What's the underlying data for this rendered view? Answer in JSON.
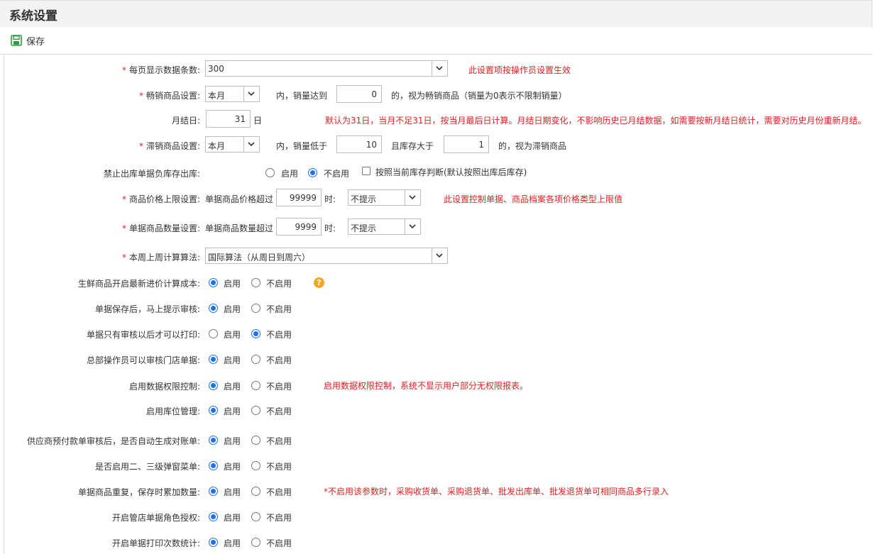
{
  "title": "系统设置",
  "toolbar": {
    "save_label": "保存"
  },
  "colors": {
    "accent": "#1a73e8",
    "note": "#e02020",
    "save_icon": "#2e9b3e",
    "help": "#f5a623"
  },
  "rows": {
    "pagesize": {
      "required": "*",
      "label": "每页显示数据条数:",
      "value": "300",
      "note": "此设置项按操作员设置生效"
    },
    "bestseller": {
      "required": "*",
      "label": "畅销商品设置:",
      "period": "本月",
      "t1": "内，销量达到",
      "qty": "0",
      "t2": "的，视为畅销商品（销量为0表示不限制销量）"
    },
    "monthend": {
      "label": "月结日:",
      "day": "31",
      "unit": "日",
      "note": "默认为31日，当月不足31日，按当月最后日计算。月结日期变化，不影响历史已月结数据，如需要按新月结日统计，需要对历史月份重新月结。"
    },
    "slowseller": {
      "required": "*",
      "label": "滞销商品设置:",
      "period": "本月",
      "t1": "内，销量低于",
      "qty": "10",
      "t2": "且库存大于",
      "stock": "1",
      "t3": "的，视为滞销商品"
    },
    "negstock": {
      "label": "禁止出库单据负库存出库:",
      "enable": "启用",
      "disable": "不启用",
      "check_label": "按照当前库存判断(默认按照出库后库存)"
    },
    "pricelimit": {
      "required": "*",
      "label": "商品价格上限设置:",
      "t1": "单据商品价格超过",
      "value": "99999",
      "t2": "时:",
      "action": "不提示",
      "note": "此设置控制单据、商品档案各项价格类型上限值"
    },
    "qtylimit": {
      "required": "*",
      "label": "单据商品数量设置:",
      "t1": "单据商品数量超过",
      "value": "9999",
      "t2": "时:",
      "action": "不提示"
    },
    "weekcalc": {
      "required": "*",
      "label": "本周上周计算算法:",
      "value": "国际算法（从周日到周六）"
    },
    "fresh": {
      "label": "生鲜商品开启最新进价计算成本:",
      "enable": "启用",
      "disable": "不启用",
      "help": "?"
    },
    "auditprompt": {
      "label": "单据保存后，马上提示审核:",
      "enable": "启用",
      "disable": "不启用"
    },
    "printafter": {
      "label": "单据只有审核以后才可以打印:",
      "enable": "启用",
      "disable": "不启用"
    },
    "hqaudit": {
      "label": "总部操作员可以审核门店单据:",
      "enable": "启用",
      "disable": "不启用"
    },
    "dataperm": {
      "label": "启用数据权限控制:",
      "enable": "启用",
      "disable": "不启用",
      "note": "启用数据权限控制，系统不显示用户部分无权限报表。"
    },
    "location": {
      "label": "启用库位管理:",
      "enable": "启用",
      "disable": "不启用"
    },
    "supplier": {
      "label": "供应商预付款单审核后，是否自动生成对账单:",
      "enable": "启用",
      "disable": "不启用"
    },
    "popup": {
      "label": "是否启用二、三级弹窗菜单:",
      "enable": "启用",
      "disable": "不启用"
    },
    "dupitem": {
      "label": "单据商品重复，保存时累加数量:",
      "enable": "启用",
      "disable": "不启用",
      "note": "*不启用该参数时，采购收货单、采购退货单、批发出库单、批发退货单可相同商品多行录入"
    },
    "storerole": {
      "label": "开启管店单据角色授权:",
      "enable": "启用",
      "disable": "不启用"
    },
    "printcount": {
      "label": "开启单据打印次数统计:",
      "enable": "启用",
      "disable": "不启用"
    }
  }
}
